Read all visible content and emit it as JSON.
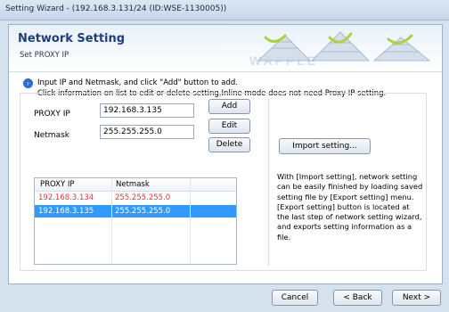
{
  "window": {
    "title": "Setting Wizard - (192.168.3.131/24 (ID:WSE-1130005))"
  },
  "header": {
    "title": "Network Setting",
    "subtitle": "Set PROXY IP",
    "banner_logo": "WAPPLE"
  },
  "info": {
    "line1": "Input IP and Netmask, and click \"Add\" button to add.",
    "line2": "Click information on list to edit or delete setting.Inline mode does not need Proxy IP setting."
  },
  "form": {
    "proxy_ip_label": "PROXY IP",
    "proxy_ip_value": "192.168.3.135",
    "netmask_label": "Netmask",
    "netmask_value": "255.255.255.0"
  },
  "buttons": {
    "add": "Add",
    "edit": "Edit",
    "delete": "Delete",
    "import": "Import setting..."
  },
  "list": {
    "columns": [
      "PROXY IP",
      "Netmask"
    ],
    "rows": [
      {
        "ip": "192.168.3.134",
        "mask": "255.255.255.0"
      },
      {
        "ip": "192.168.3.135",
        "mask": "255.255.255.0"
      }
    ]
  },
  "description": [
    "With [Import setting], network setting",
    "can be easily finished by loading saved",
    "setting file by [Export setting] menu.",
    "[Export setting] button is located at",
    "the last step of network setting wizard,",
    "and exports setting information as a",
    "file."
  ],
  "footer": {
    "cancel": "Cancel",
    "back": "< Back",
    "next": "Next >"
  },
  "colors": {
    "title_blue": "#1f3f7a",
    "selected_row": "#3399ff",
    "error_red": "#e23636"
  },
  "icons": {
    "info_bullet": "info-bullet-icon"
  }
}
